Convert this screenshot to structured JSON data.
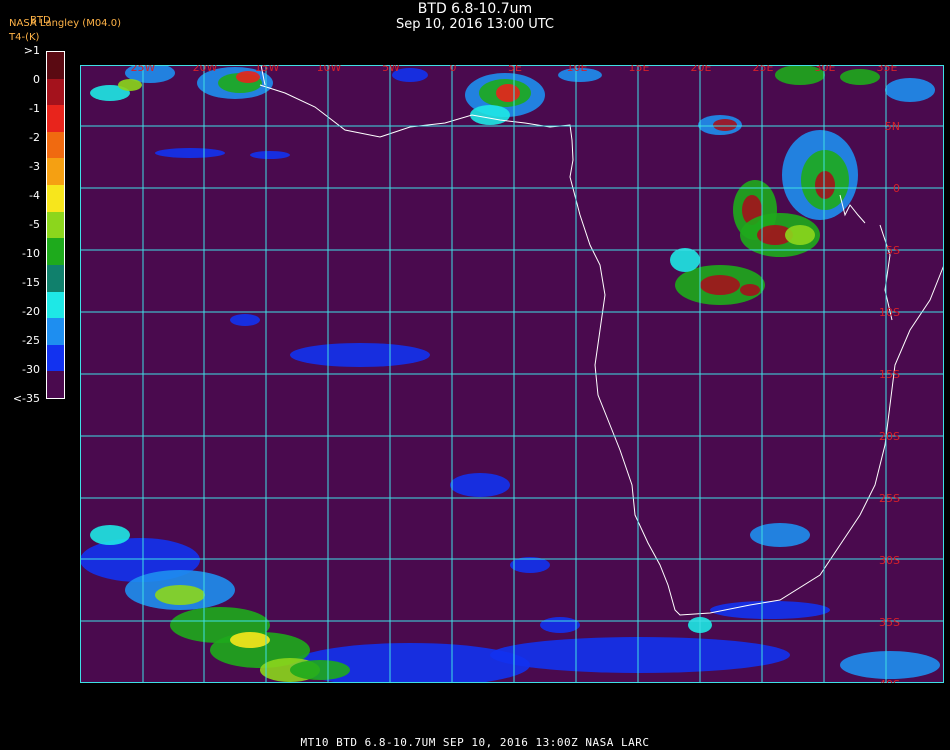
{
  "header": {
    "title": "BTD 6.8-10.7um",
    "subtitle": "Sep 10, 2016 13:00 UTC",
    "credit_org": "NASA Langley (M04.0)",
    "credit_overlay": "BTD",
    "credit_units": "T4-(K)"
  },
  "legend": {
    "ticks": [
      ">1",
      "0",
      "-1",
      "-2",
      "-3",
      "-4",
      "-5",
      "-10",
      "-15",
      "-20",
      "-25",
      "-30",
      "<-35"
    ],
    "colors": [
      "#5a0a12",
      "#a4121c",
      "#e8241c",
      "#f06a10",
      "#f5a012",
      "#f7e61c",
      "#8cd61c",
      "#1eaa1c",
      "#10806c",
      "#1ee8e6",
      "#1e8ef0",
      "#1232f0",
      "#4a0a4e"
    ]
  },
  "map": {
    "background": "#4a0a4e",
    "grid_color": "#3fe0e6",
    "coast_color": "#ffffff",
    "longitude_labels": [
      "25W",
      "20W",
      "15W",
      "10W",
      "5W",
      "0",
      "5E",
      "10E",
      "15E",
      "20E",
      "25E",
      "30E",
      "35E"
    ],
    "latitude_labels": [
      "5N",
      "0",
      "5S",
      "10S",
      "15S",
      "20S",
      "25S",
      "30S",
      "35S",
      "40S"
    ]
  },
  "footer": {
    "text": "MT10   BTD 6.8-10.7UM    SEP 10, 2016 13:00Z    NASA LARC"
  }
}
